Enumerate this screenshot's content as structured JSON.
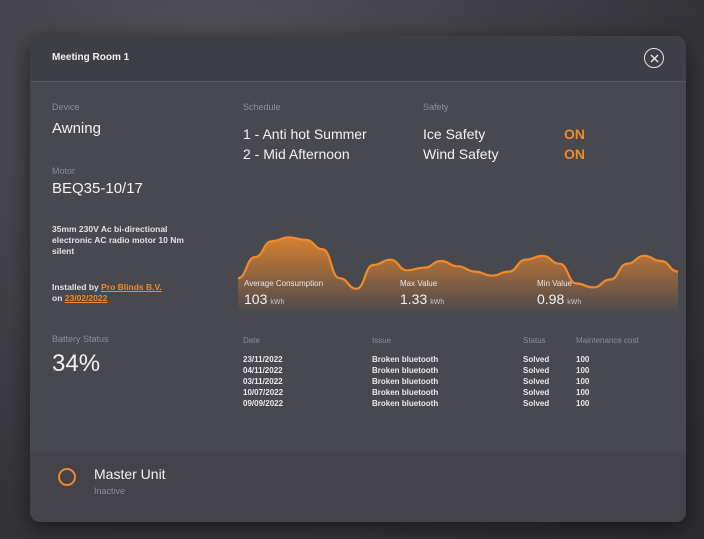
{
  "modal": {
    "title": "Meeting Room 1"
  },
  "device": {
    "label": "Device",
    "value": "Awning"
  },
  "motor": {
    "label": "Motor",
    "value": "BEQ35-10/17",
    "description": "35mm 230V Ac bi-directional electronic AC radio motor 10 Nm silent"
  },
  "installed": {
    "prefix": "Installed by",
    "installer": "Pro Blinds B.V.",
    "on_prefix": "on",
    "date": "23/02/2022"
  },
  "battery": {
    "label": "Battery Status",
    "value": "34%"
  },
  "schedule": {
    "label": "Schedule",
    "items": [
      "1 - Anti hot Summer",
      "2 - Mid Afternoon"
    ]
  },
  "safety": {
    "label": "Safety",
    "items": [
      {
        "name": "Ice Safety",
        "state": "ON"
      },
      {
        "name": "Wind Safety",
        "state": "ON"
      }
    ]
  },
  "consumption": {
    "average_label": "Average Consumption",
    "average_value": "103",
    "average_unit": "kWh",
    "max_label": "Max Value",
    "max_value": "1.33",
    "max_unit": "kWh",
    "min_label": "Min Value",
    "min_value": "0.98",
    "min_unit": "kWh"
  },
  "chart_data": {
    "type": "area",
    "series_color": "#f08a2a",
    "values": [
      0.3,
      0.62,
      0.86,
      0.92,
      0.88,
      0.74,
      0.3,
      0.14,
      0.5,
      0.58,
      0.42,
      0.46,
      0.56,
      0.48,
      0.4,
      0.34,
      0.4,
      0.58,
      0.64,
      0.52,
      0.22,
      0.16,
      0.28,
      0.52,
      0.64,
      0.56,
      0.4
    ]
  },
  "table": {
    "headers": [
      "Date",
      "Issue",
      "Status",
      "Maintenance cost"
    ],
    "rows": [
      {
        "date": "23/11/2022",
        "issue": "Broken bluetooth",
        "status": "Solved",
        "cost": "100"
      },
      {
        "date": "04/11/2022",
        "issue": "Broken bluetooth",
        "status": "Solved",
        "cost": "100"
      },
      {
        "date": "03/11/2022",
        "issue": "Broken bluetooth",
        "status": "Solved",
        "cost": "100"
      },
      {
        "date": "10/07/2022",
        "issue": "Broken bluetooth",
        "status": "Solved",
        "cost": "100"
      },
      {
        "date": "09/09/2022",
        "issue": "Broken bluetooth",
        "status": "Solved",
        "cost": "100"
      }
    ]
  },
  "master_unit": {
    "name": "Master Unit",
    "state": "Inactive"
  },
  "colors": {
    "accent": "#f08a2a",
    "success": "#3fc63f",
    "panel": "#48484f"
  },
  "icons": {
    "close": "close-circle-icon",
    "unit": "unit-ring-icon"
  }
}
